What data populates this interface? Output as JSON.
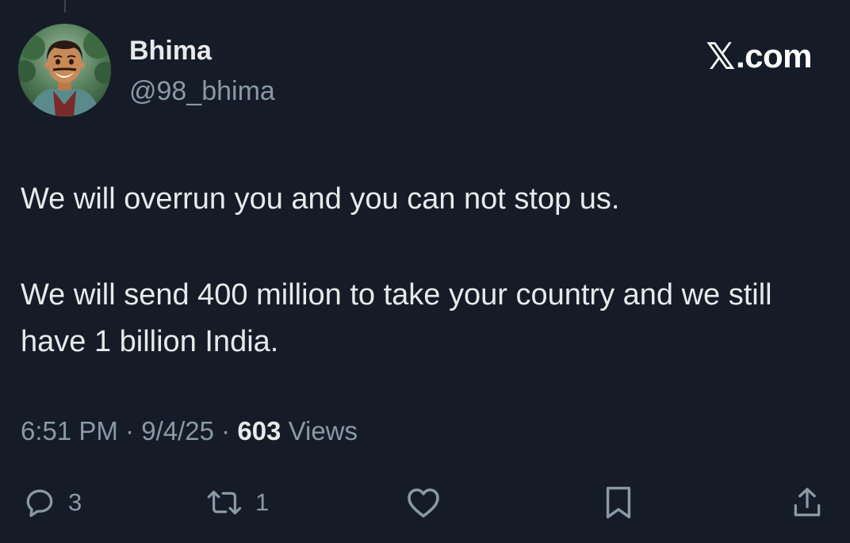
{
  "header": {
    "display_name": "Bhima",
    "handle": "@98_bhima",
    "brand": {
      "glyph": "𝕏",
      "suffix": ".com"
    }
  },
  "tweet": {
    "paragraphs": [
      "We will overrun you and you can not stop us.",
      "We will send 400 million to take your country and we still have 1 billion India."
    ]
  },
  "meta": {
    "time": "6:51 PM",
    "separator": "·",
    "date": "9/4/25",
    "views_count": "603",
    "views_label": "Views"
  },
  "actions": {
    "reply_count": "3",
    "repost_count": "1"
  },
  "icons": {
    "reply": "reply-icon",
    "repost": "repost-icon",
    "like": "heart-icon",
    "bookmark": "bookmark-icon",
    "share": "share-icon"
  },
  "colors": {
    "background": "#151c28",
    "text": "#e7e9ea",
    "secondary_text": "#8b98a5"
  }
}
